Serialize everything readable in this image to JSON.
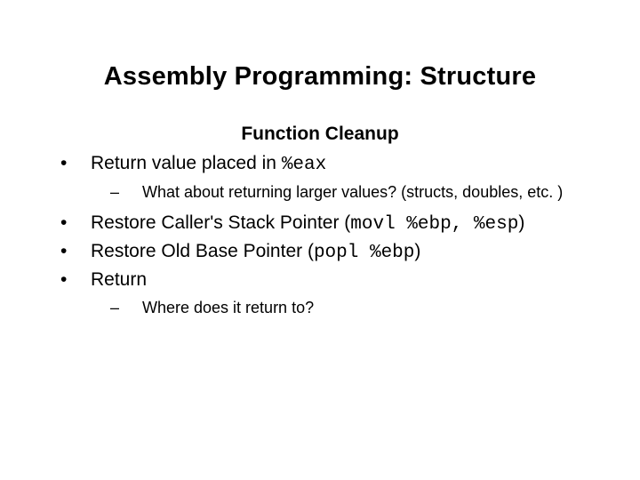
{
  "title": "Assembly Programming: Structure",
  "subtitle": "Function Cleanup",
  "bullets": {
    "b0": {
      "pre": "Return value placed in ",
      "code": "%eax"
    },
    "b0s0": "What about returning larger values? (structs, doubles, etc. )",
    "b1": {
      "pre": "Restore Caller's Stack Pointer (",
      "code": "movl %ebp, %esp",
      "post": ")"
    },
    "b2": {
      "pre": "Restore Old Base Pointer (",
      "code": "popl %ebp",
      "post": ")"
    },
    "b3": "Return",
    "b3s0": "Where does it return to?"
  },
  "glyphs": {
    "dot": "•",
    "dash": "–"
  }
}
